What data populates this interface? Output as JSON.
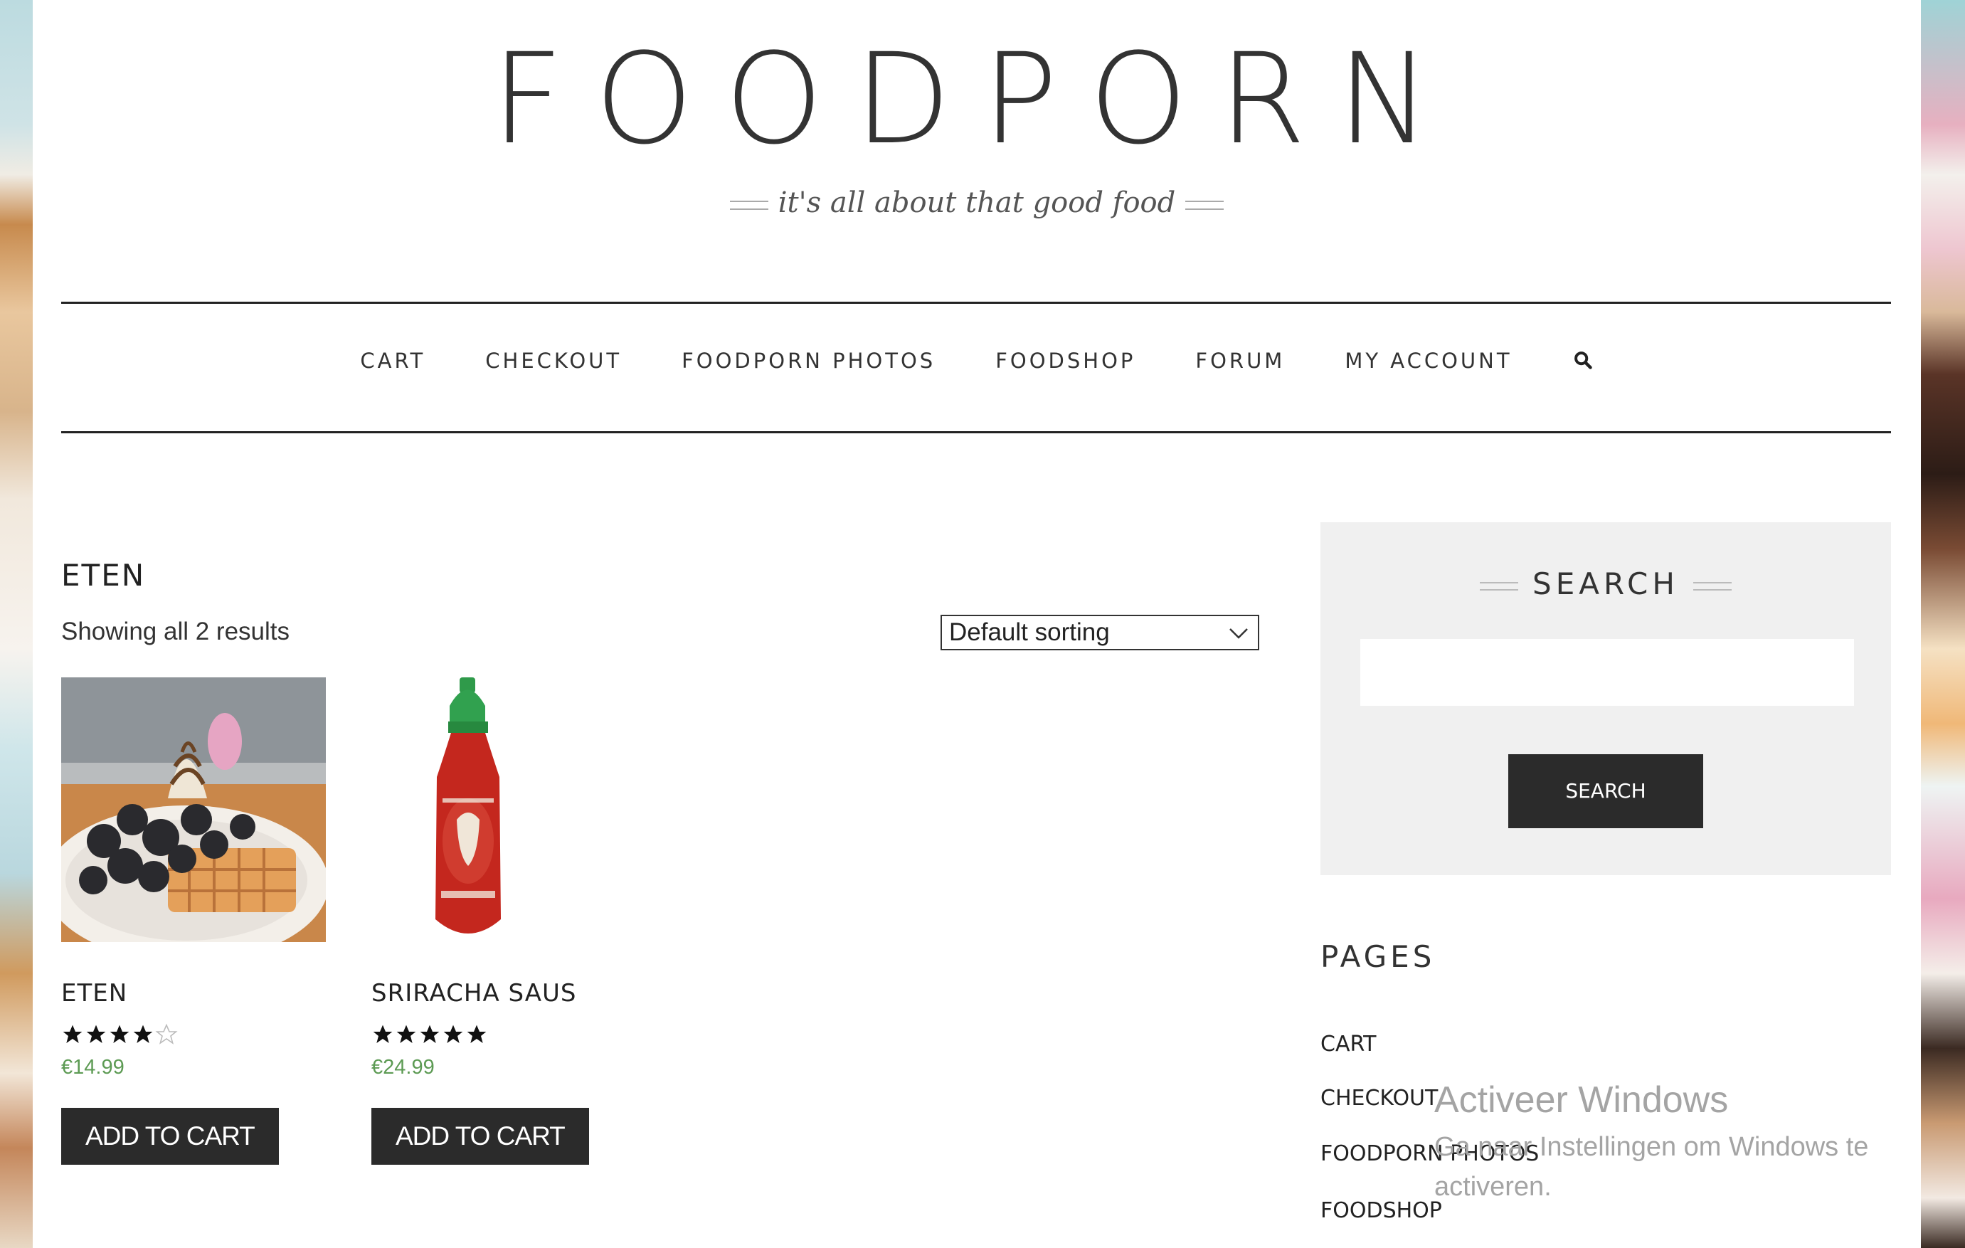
{
  "header": {
    "site_title": "FOODPORN",
    "tagline": "it's all about that good food"
  },
  "nav": {
    "items": [
      "CART",
      "CHECKOUT",
      "FOODPORN PHOTOS",
      "FOODSHOP",
      "FORUM",
      "MY ACCOUNT"
    ]
  },
  "shop": {
    "category_title": "ETEN",
    "results_text": "Showing all 2 results",
    "sort_selected": "Default sorting",
    "products": [
      {
        "name": "ETEN",
        "rating": 4,
        "rating_max": 5,
        "price": "€14.99",
        "button": "ADD TO CART"
      },
      {
        "name": "SRIRACHA SAUS",
        "rating": 5,
        "rating_max": 5,
        "price": "€24.99",
        "button": "ADD TO CART"
      }
    ]
  },
  "sidebar": {
    "search_title": "SEARCH",
    "search_value": "",
    "search_button": "SEARCH",
    "pages_title": "PAGES",
    "pages": [
      "CART",
      "CHECKOUT",
      "FOODPORN PHOTOS",
      "FOODSHOP"
    ]
  },
  "watermark": {
    "title": "Activeer Windows",
    "subtitle": "Ga naar Instellingen om Windows te activeren."
  },
  "colors": {
    "price": "#5d9b54",
    "button_bg": "#2b2b2b",
    "sidebar_bg": "#f0f0f0"
  }
}
